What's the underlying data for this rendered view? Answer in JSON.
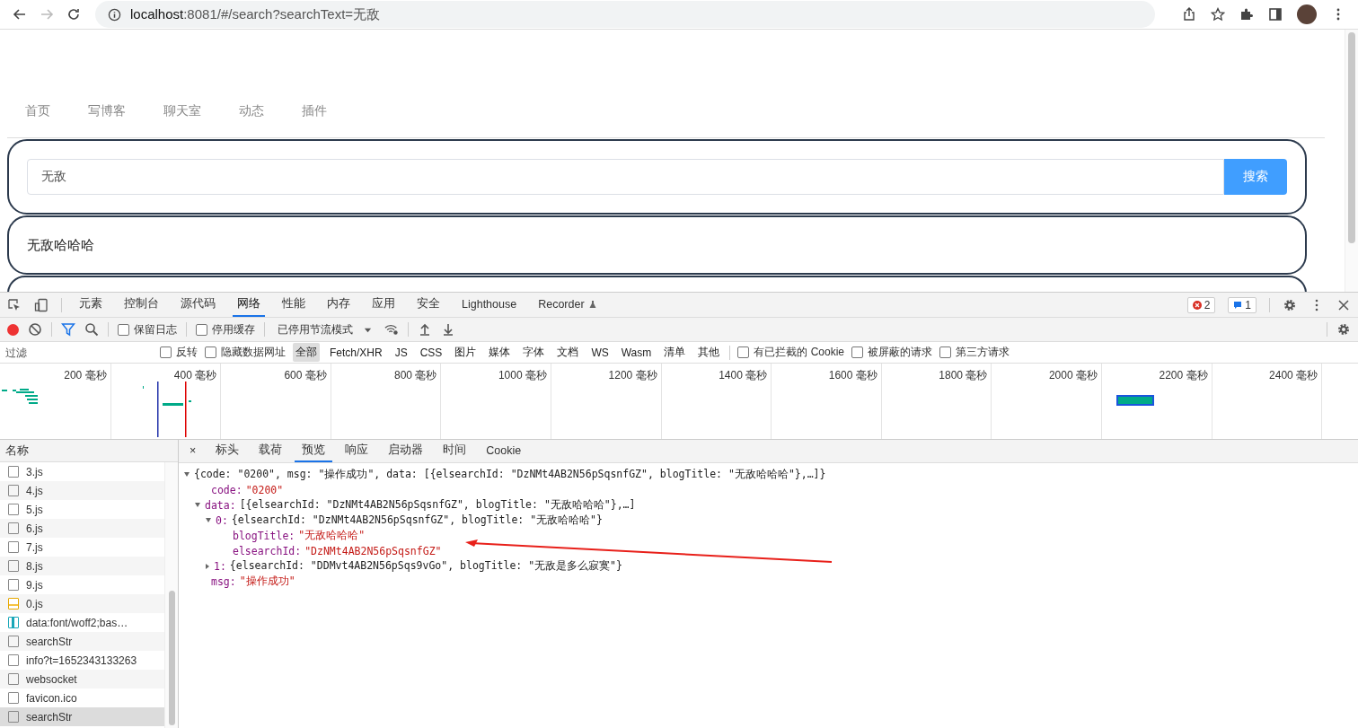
{
  "browser": {
    "url_host": "localhost",
    "url_rest": ":8081/#/search?searchText=无敌"
  },
  "nav": [
    {
      "label": "首页"
    },
    {
      "label": "写博客"
    },
    {
      "label": "聊天室"
    },
    {
      "label": "动态"
    },
    {
      "label": "插件"
    }
  ],
  "search": {
    "value": "无敌",
    "button": "搜索"
  },
  "results": [
    {
      "title": "无敌哈哈哈"
    }
  ],
  "devtools": {
    "panel_tabs": [
      {
        "label": "元素",
        "selected": false,
        "kind": "plain"
      },
      {
        "label": "控制台",
        "selected": false,
        "kind": "plain"
      },
      {
        "label": "源代码",
        "selected": false,
        "kind": "plain"
      },
      {
        "label": "网络",
        "selected": true,
        "kind": "plain"
      },
      {
        "label": "性能",
        "selected": false,
        "kind": "plain"
      },
      {
        "label": "内存",
        "selected": false,
        "kind": "plain"
      },
      {
        "label": "应用",
        "selected": false,
        "kind": "plain"
      },
      {
        "label": "安全",
        "selected": false,
        "kind": "plain"
      },
      {
        "label": "Lighthouse",
        "selected": false,
        "kind": "plain"
      },
      {
        "label": "Recorder",
        "selected": false,
        "kind": "experimental"
      }
    ],
    "errors": "2",
    "messages": "1",
    "recording": true,
    "toolbar_checks": [
      {
        "label": "保留日志",
        "checked": false
      },
      {
        "label": "停用缓存",
        "checked": false
      }
    ],
    "throttle": "已停用节流模式",
    "filter": {
      "placeholder": "过滤"
    },
    "filter_checks": [
      {
        "label": "反转",
        "checked": false
      },
      {
        "label": "隐藏数据网址",
        "checked": false
      }
    ],
    "types": [
      {
        "label": "全部",
        "selected": true
      },
      {
        "label": "Fetch/XHR",
        "selected": false
      },
      {
        "label": "JS",
        "selected": false
      },
      {
        "label": "CSS",
        "selected": false
      },
      {
        "label": "图片",
        "selected": false
      },
      {
        "label": "媒体",
        "selected": false
      },
      {
        "label": "字体",
        "selected": false
      },
      {
        "label": "文档",
        "selected": false
      },
      {
        "label": "WS",
        "selected": false
      },
      {
        "label": "Wasm",
        "selected": false
      },
      {
        "label": "清单",
        "selected": false
      },
      {
        "label": "其他",
        "selected": false
      }
    ],
    "extra_checks": [
      {
        "label": "有已拦截的 Cookie",
        "checked": false
      },
      {
        "label": "被屏蔽的请求",
        "checked": false
      },
      {
        "label": "第三方请求",
        "checked": false
      }
    ],
    "ticks": [
      "200 毫秒",
      "400 毫秒",
      "600 毫秒",
      "800 毫秒",
      "1000 毫秒",
      "1200 毫秒",
      "1400 毫秒",
      "1600 毫秒",
      "1800 毫秒",
      "2000 毫秒",
      "2200 毫秒",
      "2400 毫秒"
    ],
    "name_header": "名称",
    "requests": [
      {
        "name": "3.js",
        "kind": "doc",
        "selected": false
      },
      {
        "name": "4.js",
        "kind": "doc",
        "selected": false
      },
      {
        "name": "5.js",
        "kind": "doc",
        "selected": false
      },
      {
        "name": "6.js",
        "kind": "doc",
        "selected": false
      },
      {
        "name": "7.js",
        "kind": "doc",
        "selected": false
      },
      {
        "name": "8.js",
        "kind": "doc",
        "selected": false
      },
      {
        "name": "9.js",
        "kind": "doc",
        "selected": false
      },
      {
        "name": "0.js",
        "kind": "script",
        "selected": false
      },
      {
        "name": "data:font/woff2;bas…",
        "kind": "font",
        "selected": false
      },
      {
        "name": "searchStr",
        "kind": "doc",
        "selected": false
      },
      {
        "name": "info?t=1652343133263",
        "kind": "doc",
        "selected": false
      },
      {
        "name": "websocket",
        "kind": "doc",
        "selected": false
      },
      {
        "name": "favicon.ico",
        "kind": "doc",
        "selected": false
      },
      {
        "name": "searchStr",
        "kind": "doc",
        "selected": true
      }
    ],
    "close": "×",
    "detail_tabs": [
      {
        "label": "标头",
        "selected": false
      },
      {
        "label": "载荷",
        "selected": false
      },
      {
        "label": "预览",
        "selected": true
      },
      {
        "label": "响应",
        "selected": false
      },
      {
        "label": "启动器",
        "selected": false
      },
      {
        "label": "时间",
        "selected": false
      },
      {
        "label": "Cookie",
        "selected": false
      }
    ],
    "tree": [
      {
        "kind": "object",
        "expanded": true,
        "summary": "{code: \"0200\", msg: \"操作成功\", data: [{elsearchId: \"DzNMt4AB2N56pSqsnfGZ\", blogTitle: \"无敌哈哈哈\"},…]}",
        "children": [
          {
            "kind": "string",
            "key": "code:",
            "value": "\"0200\""
          },
          {
            "kind": "object",
            "key": "data:",
            "expanded": true,
            "summary": "[{elsearchId: \"DzNMt4AB2N56pSqsnfGZ\", blogTitle: \"无敌哈哈哈\"},…]",
            "children": [
              {
                "kind": "object",
                "key": "0:",
                "expanded": true,
                "summary": "{elsearchId: \"DzNMt4AB2N56pSqsnfGZ\", blogTitle: \"无敌哈哈哈\"}",
                "children": [
                  {
                    "kind": "string",
                    "key": "blogTitle:",
                    "value": "\"无敌哈哈哈\""
                  },
                  {
                    "kind": "string",
                    "key": "elsearchId:",
                    "value": "\"DzNMt4AB2N56pSqsnfGZ\""
                  }
                ]
              },
              {
                "kind": "object",
                "key": "1:",
                "expanded": false,
                "summary": "{elsearchId: \"DDMvt4AB2N56pSqs9vGo\", blogTitle: \"无敌是多么寂寞\"}"
              }
            ]
          },
          {
            "kind": "string",
            "key": "msg:",
            "value": "\"操作成功\""
          }
        ]
      }
    ]
  }
}
